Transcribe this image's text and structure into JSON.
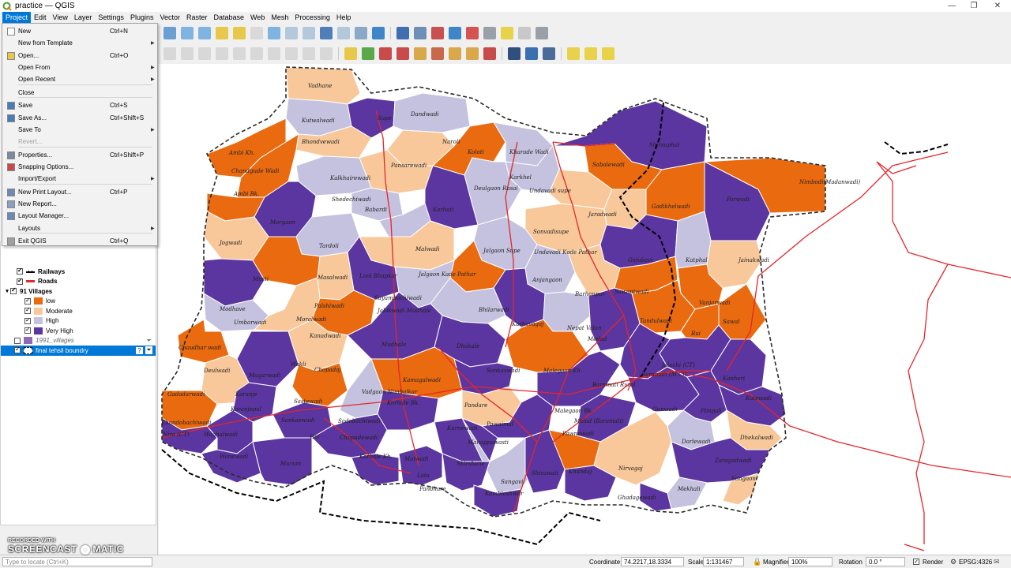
{
  "window": {
    "title": "practice — QGIS",
    "controls": [
      "minimize",
      "maximize",
      "close"
    ]
  },
  "menubar": [
    "Project",
    "Edit",
    "View",
    "Layer",
    "Settings",
    "Plugins",
    "Vector",
    "Raster",
    "Database",
    "Web",
    "Mesh",
    "Processing",
    "Help"
  ],
  "project_menu": [
    {
      "label": "New",
      "shortcut": "Ctrl+N",
      "icon": "new-project-icon"
    },
    {
      "label": "New from Template",
      "shortcut": "",
      "submenu": true
    },
    {
      "label": "Open...",
      "shortcut": "Ctrl+O",
      "icon": "open-folder-icon"
    },
    {
      "label": "Open From",
      "shortcut": "",
      "submenu": true
    },
    {
      "label": "Open Recent",
      "shortcut": "",
      "submenu": true
    },
    {
      "label": "Close",
      "shortcut": ""
    },
    {
      "label": "Save",
      "shortcut": "Ctrl+S",
      "icon": "save-icon"
    },
    {
      "label": "Save As...",
      "shortcut": "Ctrl+Shift+S",
      "icon": "save-as-icon"
    },
    {
      "label": "Save To",
      "shortcut": "",
      "submenu": true
    },
    {
      "label": "Revert...",
      "shortcut": "",
      "disabled": true
    },
    {
      "label": "Properties...",
      "shortcut": "Ctrl+Shift+P",
      "icon": "properties-icon"
    },
    {
      "label": "Snapping Options...",
      "shortcut": "",
      "icon": "snapping-icon"
    },
    {
      "label": "Import/Export",
      "shortcut": "",
      "submenu": true
    },
    {
      "label": "New Print Layout...",
      "shortcut": "Ctrl+P",
      "icon": "print-layout-icon"
    },
    {
      "label": "New Report...",
      "shortcut": "",
      "icon": "report-icon"
    },
    {
      "label": "Layout Manager...",
      "shortcut": "",
      "icon": "layout-manager-icon"
    },
    {
      "label": "Layouts",
      "shortcut": "",
      "submenu": true
    },
    {
      "label": "Exit QGIS",
      "shortcut": "Ctrl+Q",
      "icon": "exit-icon"
    }
  ],
  "layers": {
    "railways": "Railways",
    "roads": "Roads",
    "villages": "91 Villages",
    "classes": [
      {
        "label": "low",
        "color": "#ea6a0f"
      },
      {
        "label": "Moderate",
        "color": "#f8c89a"
      },
      {
        "label": "High",
        "color": "#c4c2df"
      },
      {
        "label": "Very High",
        "color": "#5b35a0"
      }
    ],
    "villages_1991": "1991_villages",
    "boundary": "final tehsil boundry"
  },
  "map": {
    "labels": [
      "Vadhane",
      "Kutwalwadi",
      "Supe",
      "Dandwadi",
      "Bhondvewadi",
      "Naroli",
      "Koloti",
      "Kharade Wadi",
      "Shirsuphal",
      "Ambi Kh.",
      "Chandgude Wadi",
      "Pansarewadi",
      "Karkhel",
      "Sabalewadi",
      "Nimbodi(Madanwadi)",
      "Ambi Bk.",
      "Kalkhairewadi",
      "Deulgaon Rasal",
      "Undavadi supe",
      "Gadikhelwadi",
      "Shedechiwadi",
      "Jaradwadi",
      "Parwadi",
      "Morgaon",
      "Karhati",
      "Babardi",
      "Jogwadi",
      "Tardoli",
      "Sonvadisupe",
      "Malwadi",
      "Jalgaon Supe",
      "Gojubavi",
      "Katphal",
      "Jainakwadi",
      "Murti",
      "Loni Bhapkar",
      "Undavadi Kade Pathar",
      "Anjangaon",
      "Masalwadi",
      "Jalgaon Kade Pathar",
      "Modhave",
      "Palshiwadi",
      "Sayambachiwadi",
      "Barhanpur",
      "Sawantwadi",
      "Vanjarwadi",
      "Bhilarwadi",
      "Jalakwadi Mudhale",
      "Umbarwadi",
      "Moralwadi",
      "Karhavagaj",
      "Tandulwadi",
      "Sawal",
      "Nepat Valan",
      "Medad",
      "Rui",
      "Kanadwadi",
      "Mudhale",
      "Dhakale",
      "Chaudhar wadi",
      "Wakli",
      "Chopadaj",
      "Malegaon Kh.",
      "Jalochi (CT)",
      "Baramati (M Cl)",
      "Baramati Rural",
      "Sonkaswadi",
      "Kanheri",
      "Deulwadi",
      "Magarwadi",
      "Kamagalwadi",
      "Katewadi",
      "Karanje",
      "Gadadarwadi",
      "Vadgaon Nimbalkar",
      "Sastewadi",
      "Korhale Bk.",
      "Pandare",
      "Malegaon Bk.",
      "Gunwadi",
      "Pimpali",
      "Karanjepul",
      "Khandobachiwadi",
      "Sadobachiwadi",
      "Pawaimal",
      "Malad (Baramati)",
      "Nira (CT)",
      "Waghalwadi",
      "Sonkaswadi",
      "Kurnewadi",
      "Pawnewadi",
      "Dorlewadi",
      "Dhekalwadi",
      "Hol",
      "Chopadewadi",
      "Manappawasti",
      "Zaragadwadi",
      "Wanewadi",
      "Murum",
      "Korhale Kh.",
      "Malwadi",
      "Shirshane",
      "Khandaj",
      "Nirvagaj",
      "Songaon",
      "Lata",
      "Sangavi",
      "Shirawali",
      "Pandhare",
      "Kambleshwar",
      "Mekhali",
      "Ghadagewadi"
    ]
  },
  "statusbar": {
    "locator_placeholder": "Type to locate (Ctrl+K)",
    "coordinate_label": "Coordinate",
    "coordinate_value": "74.2217,18.3334",
    "scale_label": "Scale",
    "scale_value": "1:131467",
    "magnifier_label": "Magnifier",
    "magnifier_value": "100%",
    "rotation_label": "Rotation",
    "rotation_value": "0.0 °",
    "render_label": "Render",
    "crs": "EPSG:4326"
  },
  "watermark": {
    "top": "RECORDED WITH",
    "main": "SCREENCAST",
    "suffix": "MATIC"
  }
}
